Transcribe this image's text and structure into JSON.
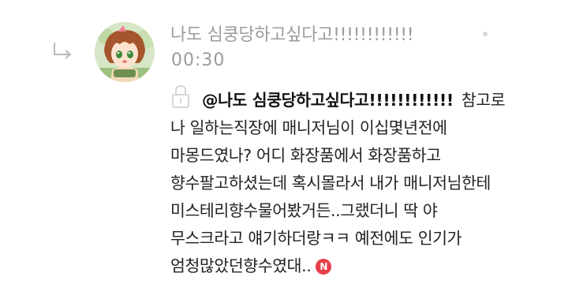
{
  "comment": {
    "author": "나도 심쿵당하고싶다고!!!!!!!!!!!!",
    "timestamp": "00:30",
    "mention": "@나도 심쿵당하고싶다고!!!!!!!!!!!!",
    "body_lines": [
      "참고로",
      "나 일하는직장에 매니저님이 이십몇년전에",
      "마몽드였나? 어디 화장품에서 화장품하고",
      "향수팔고하셨는데 혹시몰라서 내가 매니저님한테",
      "미스테리향수물어봤거든..그랬더니 딱 야",
      "무스크라고 얘기하더랑ㅋㅋ 예전에도 인기가",
      "엄청많았던향수였대.."
    ],
    "new_badge": "N",
    "icons": {
      "reply": "reply-arrow-icon",
      "lock": "lock-icon",
      "avatar": "avatar"
    },
    "colors": {
      "meta_text": "#9b9b9b",
      "body_text": "#222222",
      "badge": "#e8404b"
    }
  }
}
